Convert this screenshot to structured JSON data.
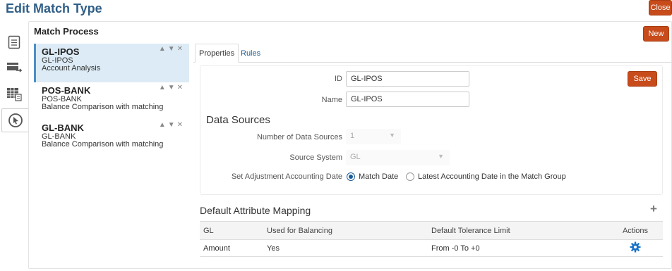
{
  "page": {
    "title": "Edit Match Type"
  },
  "buttons": {
    "close": "Close",
    "new": "New",
    "save": "Save"
  },
  "match_process": {
    "title": "Match Process",
    "items": [
      {
        "name": "GL-IPOS",
        "id": "GL-IPOS",
        "type": "Account Analysis",
        "selected": true
      },
      {
        "name": "POS-BANK",
        "id": "POS-BANK",
        "type": "Balance Comparison with matching",
        "selected": false
      },
      {
        "name": "GL-BANK",
        "id": "GL-BANK",
        "type": "Balance Comparison with matching",
        "selected": false
      }
    ],
    "controls": "▲▼✕"
  },
  "tabs": [
    {
      "label": "Properties",
      "active": true
    },
    {
      "label": "Rules",
      "active": false
    }
  ],
  "properties": {
    "id_label": "ID",
    "id_value": "GL-IPOS",
    "name_label": "Name",
    "name_value": "GL-IPOS"
  },
  "data_sources": {
    "title": "Data Sources",
    "num_label": "Number of Data Sources",
    "num_value": "1",
    "source_label": "Source System",
    "source_value": "GL",
    "adj_label": "Set Adjustment Accounting Date",
    "radio_match": "Match Date",
    "radio_latest": "Latest Accounting Date in the Match Group",
    "selected": "match"
  },
  "attribute_mapping": {
    "title": "Default Attribute Mapping",
    "columns": [
      "GL",
      "Used for Balancing",
      "Default Tolerance Limit",
      "Actions"
    ],
    "rows": [
      {
        "gl": "Amount",
        "balancing": "Yes",
        "tolerance": "From -0 To +0"
      }
    ]
  },
  "colors": {
    "accent": "#c74b1b",
    "title": "#2f5e87",
    "selection": "#dcebf5",
    "gear": "#1a73c8"
  }
}
